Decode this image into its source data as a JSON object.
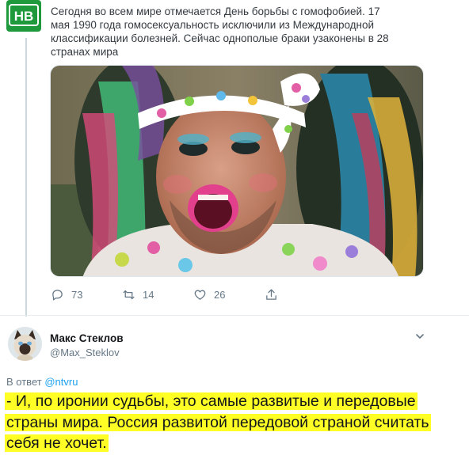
{
  "news_tweet": {
    "avatar_text": "НВ",
    "avatar_colors": {
      "background": "#1e9a3c",
      "text": "#ffffff"
    },
    "text": "Сегодня во всем мире отмечается День борьбы с гомофобией. 17 мая 1990 года гомосексуальность исключили из Международной классификации болезней. Сейчас однополые браки узаконены в 28 странах мира",
    "photo_icon": "person-with-rainbow-wig-photo",
    "actions": {
      "replies": "73",
      "retweets": "14",
      "likes": "26"
    }
  },
  "reply_tweet": {
    "author_name": "Макс Стеклов",
    "author_handle": "@Max_Steklov",
    "avatar_icon": "siamese-cat-avatar",
    "reply_prefix": "В ответ",
    "reply_handle": "@ntvru",
    "text": "- И, по иронии судьбы, это самые развитые и передовые страны мира. Россия развитой передовой страной считать себя не хочет.",
    "highlight_color": "#ffff26"
  },
  "colors": {
    "link": "#1da1f2",
    "muted": "#657786"
  }
}
